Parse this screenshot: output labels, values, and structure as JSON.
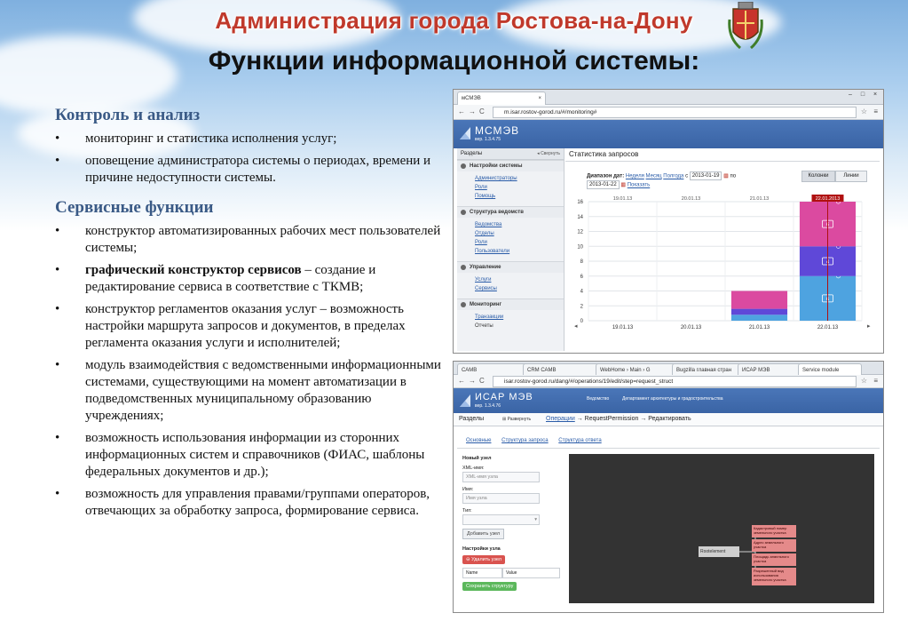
{
  "header": {
    "org_title": "Администрация города Ростова-на-Дону",
    "slide_title": "Функции информационной системы:"
  },
  "left": {
    "section1": {
      "heading": "Контроль и анализ",
      "items": [
        "мониторинг и статистика исполнения услуг;",
        "оповещение администратора системы о периодах, времени и причине недоступности системы."
      ]
    },
    "section2": {
      "heading": "Сервисные функции",
      "items": [
        {
          "text": "конструктор автоматизированных рабочих мест пользователей системы;"
        },
        {
          "bold": "графический конструктор сервисов",
          "text": " – создание и редактирование сервиса в соответствие с ТКМВ;"
        },
        {
          "text": "конструктор регламентов оказания услуг – возможность настройки маршрута запросов и документов, в пределах регламента оказания услуги и исполнителей;"
        },
        {
          "text": "модуль взаимодействия с ведомственными информационными системами, существующими на момент автоматизации в подведомственных муниципальному  образованию учреждениях;"
        },
        {
          "text": "возможность использования информации из сторонних информационных систем и справочников (ФИАС, шаблоны федеральных документов и др.);"
        },
        {
          "text": "возможность для управления правами/группами операторов, отвечающих за обработку запроса, формирование сервиса."
        }
      ]
    }
  },
  "shot1": {
    "tab": "мСМЭВ",
    "url": "m.isar.rostov-gorod.ru/#/monitoring#",
    "logo": "МСМЭВ",
    "version": "вер. 1.3.4.75",
    "sidebar_title": "Разделы",
    "sidebar_collapse": "◂ Свернуть",
    "groups": [
      {
        "title": "Настройки системы",
        "links": [
          "Администраторы",
          "Роли",
          "Помощь"
        ]
      },
      {
        "title": "Структура ведомств",
        "links": [
          "Ведомства",
          "Отделы",
          "Роли",
          "Пользователи"
        ]
      },
      {
        "title": "Управление",
        "links": [
          "Услуги",
          "Сервисы"
        ]
      },
      {
        "title": "Мониторинг",
        "links": [
          "Транзакции"
        ],
        "plain": [
          "Отчеты"
        ]
      }
    ],
    "content_title": "Статистика запросов",
    "range_label": "Диапазон дат:",
    "range_week": "Неделя",
    "range_month": "Месяц",
    "range_year": "Полгода",
    "from_label": "с",
    "from_value": "2013-01-19",
    "to_label": "по",
    "to_value": "2013-01-22",
    "show": "Показать",
    "btn_columns": "Колонки",
    "btn_lines": "Линии"
  },
  "chart_data": {
    "type": "bar",
    "stacked": true,
    "categories": [
      "19.01.13",
      "20.01.13",
      "21.01.13",
      "22.01.13"
    ],
    "series": [
      {
        "color": "#4ea3e0",
        "values": [
          0,
          0,
          0.8,
          6
        ]
      },
      {
        "color": "#5f48d8",
        "values": [
          0,
          0,
          0.8,
          4
        ]
      },
      {
        "color": "#db4aa0",
        "values": [
          0,
          0,
          2.4,
          6
        ]
      }
    ],
    "series_labels_on_last": [
      "6",
      "4",
      "6"
    ],
    "highlight_category": "22.01.2013",
    "ylim": [
      0,
      16
    ],
    "yticks": [
      0,
      2,
      4,
      6,
      8,
      10,
      12,
      14,
      16
    ],
    "title": "",
    "xlabel": "",
    "ylabel": "",
    "grid": true
  },
  "shot2": {
    "tabs": [
      "САМВ",
      "CRM САМВ",
      "WebHome › Main › G",
      "Bugzilla главная стран",
      "ИСАР МЭВ",
      "Service module"
    ],
    "url": "isar.rostov-gorod.ru/dang/#/operations/19/edit/step=request_struct",
    "logo": "ИСАР МЭВ",
    "version": "вер. 1.3.4.76",
    "nav1": "Ведомство",
    "nav2": "Департамент архитектуры и градостроительства",
    "section": "Разделы",
    "expand": "⊞ Развернуть",
    "bc_link": "Операции",
    "bc_arrow1": "→",
    "bc_item1": "RequestPermission",
    "bc_arrow2": "→",
    "bc_item2": "Редактировать",
    "subtabs": [
      "Основные",
      "Структура запроса",
      "Структура ответа"
    ],
    "form": {
      "new_node": "Новый узел",
      "xml_label": "XML-имя:",
      "xml_placeholder": "XML-имя узла",
      "name_label": "Имя:",
      "name_placeholder": "Имя узла",
      "type_label": "Тип:",
      "add_btn": "Добавить узел",
      "settings": "Настройки узла",
      "delete_btn": "⊖ Удалить узел",
      "key_name": "Name",
      "key_value": "Value",
      "save_btn": "Сохранить структуру"
    },
    "tree": {
      "root": "Rootelement",
      "children": [
        "Кадастровый номер земельного участка",
        "Адрес земельного участка",
        "Площадь земельного участка",
        "Разрешенный вид использования земельного участка"
      ]
    }
  }
}
